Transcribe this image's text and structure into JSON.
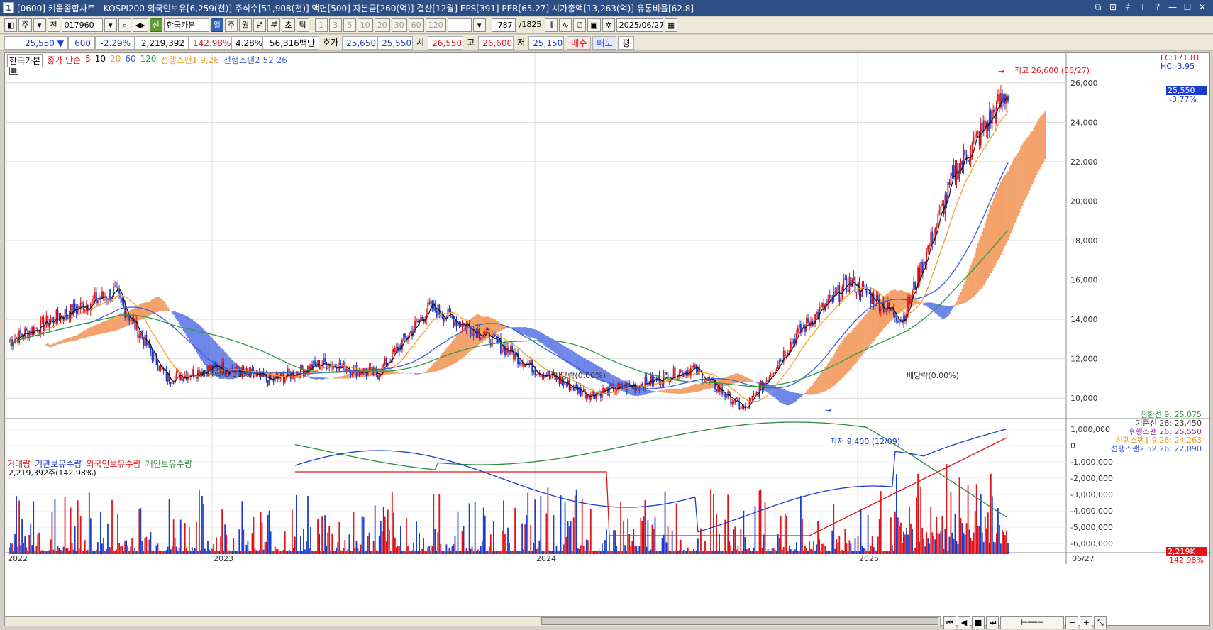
{
  "window": {
    "icon_label": "1",
    "title": "[0600] 키움종합차트 - KOSPI200 외국인보유[6,259(천)] 주식수[51,908(천)] 액면[500] 자본금[260(억)] 결산[12월] EPS[391] PER[65.27] 시가총액[13,263(억)] 유통비율[62.8]",
    "buttons": [
      "⧉",
      "⊡",
      "⫩",
      "T",
      "?",
      "—",
      "☐",
      "✕"
    ]
  },
  "toolbar": {
    "mode_a": "주",
    "mode_b": "전",
    "code": "017960",
    "new_badge": "신",
    "stock_name": "한국카본",
    "periods": [
      "일",
      "주",
      "월",
      "년",
      "분",
      "초",
      "틱"
    ],
    "selected_period": "일",
    "intervals": [
      "1",
      "3",
      "5",
      "10",
      "20",
      "30",
      "60",
      "120"
    ],
    "range": "787",
    "range_total": "/1825",
    "date": "2025/06/27"
  },
  "quote": {
    "price": "25,550",
    "arrow": "▼",
    "change": "600",
    "change_pct": "-2.29%",
    "volume": "2,219,392",
    "vol_ratio": "142.98%",
    "turnover": "4.28%",
    "amount": "56,316백만",
    "bid_label": "호가",
    "ask": "25,650",
    "bid": "25,550",
    "open_label": "시",
    "open": "26,550",
    "high_label": "고",
    "high": "26,600",
    "low_label": "저",
    "low": "25,150",
    "buy": "매수",
    "sell": "매도",
    "flat": "평"
  },
  "price_legend": {
    "name": "한국카본",
    "ma_label": "종가 단순",
    "ma": [
      "5",
      "10",
      "20",
      "60",
      "120"
    ],
    "span1": "선행스팬1 9,26",
    "span2": "선행스팬2 52,26"
  },
  "ichimoku_values": {
    "turning": "전환선 9: 25,075",
    "base": "기준선 26: 23,450",
    "lagging": "후행스팬 26: 25,550",
    "span1": "선행스팬1 9,26: 24,263",
    "span2": "선행스팬2 52,26: 22,090"
  },
  "annotations": {
    "high": "최고 26,600 (06/27)",
    "low": "최저 9,400 (12/09)",
    "div1": "배당락(0.00%)",
    "div2": "배당락(0.00%)",
    "div3": "배당락(0.00%)"
  },
  "price_axis": {
    "lc": "LC:171.81",
    "hc": "HC:-3.95",
    "current": "25,550",
    "current_pct": "-3.77%",
    "ticks": [
      "26,000",
      "24,000",
      "22,000",
      "20,000",
      "18,000",
      "16,000",
      "14,000",
      "12,000",
      "10,000"
    ]
  },
  "volume_legend": {
    "items": [
      "거래량",
      "기관보유수량",
      "외국인보유수량",
      "개인보유수량"
    ],
    "sub": "2,219,392주(142.98%)"
  },
  "volume_axis": {
    "ticks": [
      "1,000,000",
      "0",
      "-1,000,000",
      "-2,000,000",
      "-3,000,000",
      "-4,000,000",
      "-5,000,000",
      "-6,000,000"
    ],
    "current": "2,219K",
    "current_pct": "142.98%"
  },
  "time_axis": {
    "labels": [
      "2022",
      "2023",
      "2024",
      "2025"
    ],
    "last": "06/27"
  },
  "colors": {
    "up": "#e0151b",
    "down": "#1a3cd0",
    "ma20": "#f49a1b",
    "ma60": "#3b5fd9",
    "ma120": "#2e9a48",
    "cloud_up": "#f4a26b",
    "cloud_down": "#6f86e8",
    "inst": "#1a3cd0",
    "foreign": "#e0151b",
    "indiv": "#2e8b3e"
  },
  "chart_data": {
    "type": "candlestick",
    "close_path": [
      [
        "2022-01",
        12900
      ],
      [
        "2022-03",
        14200
      ],
      [
        "2022-05",
        15400
      ],
      [
        "2022-07",
        11000
      ],
      [
        "2022-09",
        11600
      ],
      [
        "2022-12",
        10900
      ],
      [
        "2023-03",
        11800
      ],
      [
        "2023-05",
        11200
      ],
      [
        "2023-07",
        14600
      ],
      [
        "2023-09",
        13300
      ],
      [
        "2023-12",
        11500
      ],
      [
        "2024-03",
        10200
      ],
      [
        "2024-06",
        10700
      ],
      [
        "2024-09",
        11500
      ],
      [
        "2024-12",
        9400
      ],
      [
        "2025-02",
        13300
      ],
      [
        "2025-03",
        15900
      ],
      [
        "2025-04",
        14000
      ],
      [
        "2025-05",
        21500
      ],
      [
        "2025-06",
        25550
      ]
    ],
    "high": 26600,
    "low": 9400,
    "ylim": [
      9400,
      26600
    ]
  }
}
